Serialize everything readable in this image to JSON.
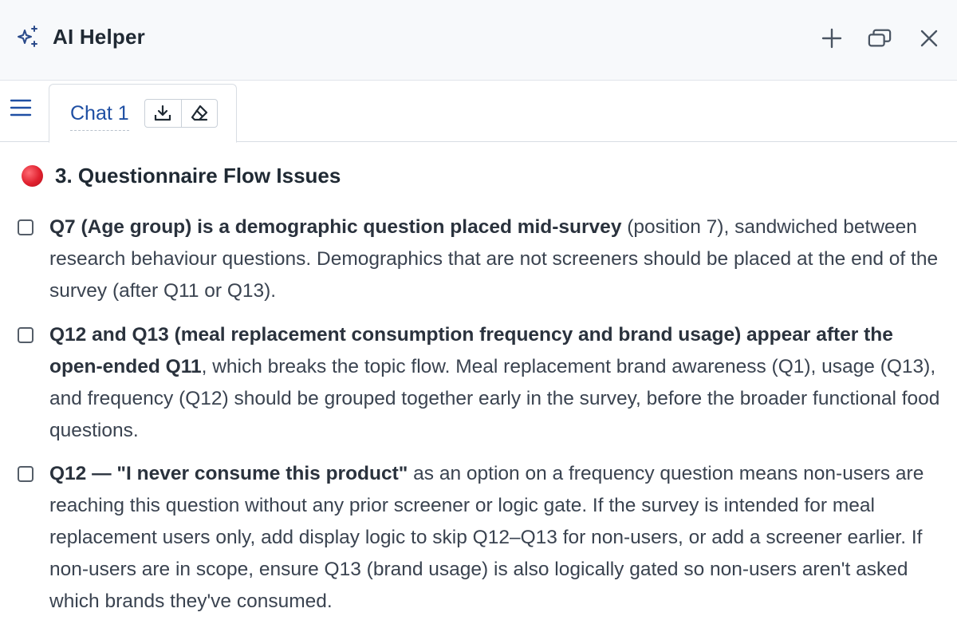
{
  "header": {
    "title": "AI Helper",
    "icon": "sparkle-icon",
    "actions": [
      "plus-icon",
      "restore-window-icon",
      "close-icon"
    ]
  },
  "tabs": [
    {
      "label": "Chat 1",
      "actions": [
        "download-icon",
        "eraser-icon"
      ]
    }
  ],
  "section": {
    "title": "3. Questionnaire Flow Issues",
    "marker_color": "#e0202e"
  },
  "items": [
    {
      "bold": "Q7 (Age group) is a demographic question placed mid-survey",
      "rest": " (position 7), sandwiched between research behaviour questions. Demographics that are not screeners should be placed at the end of the survey (after Q11 or Q13).",
      "checked": false
    },
    {
      "bold": "Q12 and Q13 (meal replacement consumption frequency and brand usage) appear after the open-ended Q11",
      "rest": ", which breaks the topic flow. Meal replacement brand awareness (Q1), usage (Q13), and frequency (Q12) should be grouped together early in the survey, before the broader functional food questions.",
      "checked": false
    },
    {
      "bold": "Q12 — \"I never consume this product\"",
      "rest": " as an option on a frequency question means non-users are reaching this question without any prior screener or logic gate. If the survey is intended for meal replacement users only, add display logic to skip Q12–Q13 for non-users, or add a screener earlier. If non-users are in scope, ensure Q13 (brand usage) is also logically gated so non-users aren't asked which brands they've consumed.",
      "checked": false
    }
  ],
  "colors": {
    "accent": "#1f4fa3",
    "header_bg": "#f7f9fb",
    "text": "#3a4350"
  }
}
